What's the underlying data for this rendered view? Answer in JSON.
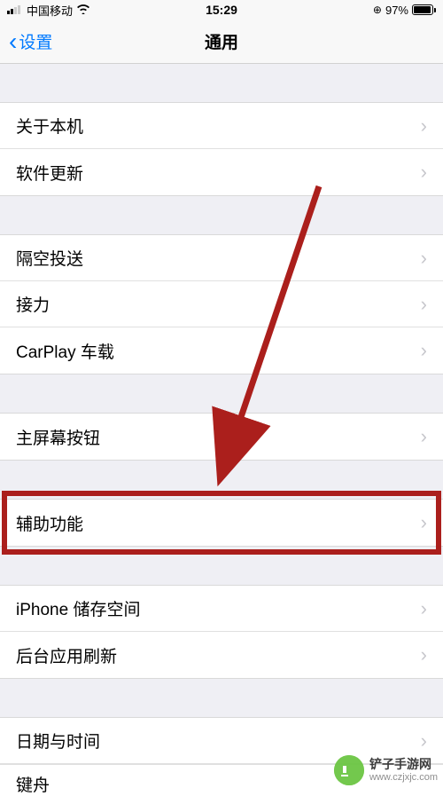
{
  "status": {
    "carrier": "中国移动",
    "time": "15:29",
    "battery_pct": "97%"
  },
  "nav": {
    "back_label": "设置",
    "title": "通用"
  },
  "sections": [
    {
      "items": [
        {
          "label": "关于本机",
          "name": "about"
        },
        {
          "label": "软件更新",
          "name": "software-update"
        }
      ]
    },
    {
      "items": [
        {
          "label": "隔空投送",
          "name": "airdrop"
        },
        {
          "label": "接力",
          "name": "handoff"
        },
        {
          "label": "CarPlay 车载",
          "name": "carplay"
        }
      ]
    },
    {
      "items": [
        {
          "label": "主屏幕按钮",
          "name": "home-button"
        }
      ]
    },
    {
      "items": [
        {
          "label": "辅助功能",
          "name": "accessibility"
        }
      ]
    },
    {
      "items": [
        {
          "label": "iPhone 储存空间",
          "name": "storage"
        },
        {
          "label": "后台应用刷新",
          "name": "background-refresh"
        }
      ]
    },
    {
      "items": [
        {
          "label": "日期与时间",
          "name": "date-time"
        }
      ]
    }
  ],
  "partial_row": "键舟",
  "watermark": {
    "name": "铲子手游网",
    "url": "www.czjxjc.com"
  },
  "annotation": {
    "highlighted_item": "accessibility"
  }
}
